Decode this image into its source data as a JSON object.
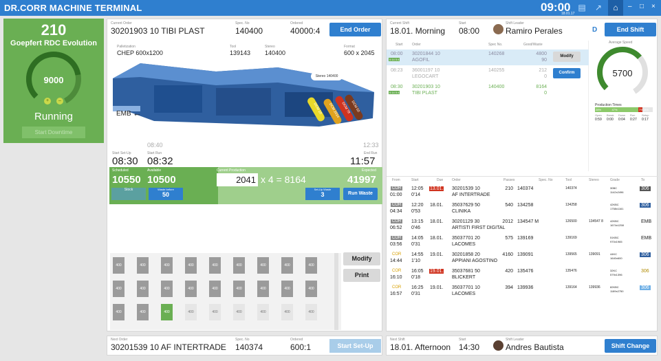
{
  "topbar": {
    "title": "DR.CORR MACHINE TERMINAL",
    "time": "09:00",
    "date": "18.01.17"
  },
  "machine": {
    "count": "210",
    "name": "Goepfert RDC Evolution",
    "speed": "9000",
    "state": "Running",
    "downtime_label": "Start Downtime",
    "speed_pct": 0.75
  },
  "order": {
    "current_label": "Current Order",
    "current": "30201903 10 TIBI PLAST",
    "spec_label": "Spec. No",
    "spec": "140400",
    "ordered_label": "Ordered",
    "ordered": "40000:4",
    "end_label": "End Order",
    "pallet_label": "Palletization",
    "pallet": "CHEP 600x1200",
    "tool_label": "Tool",
    "tool": "139143",
    "stereo_label": "Stereo",
    "stereo": "140400",
    "format_label": "Format",
    "format": "600 x 2045",
    "emb": "EMB",
    "sticker": "Stereo 140400",
    "tags": [
      "DCM 10",
      "DCM 2014",
      "DCM 78",
      "DCM 50"
    ],
    "t1": "08:40",
    "t2": "12:33",
    "setup_label": "Start Set-Up",
    "setup": "08:30",
    "run_label": "Start Run",
    "run": "08:32",
    "endrun_label": "End Run",
    "endrun": "11:57",
    "sched_label": "Scheduled",
    "sched": "10550",
    "avail_label": "Available",
    "avail": "10500",
    "curprod_label": "Current Production",
    "curprod": "2041",
    "formula": "x 4 = 8164",
    "expected_label": "Expected",
    "expected": "41997",
    "stock_label": "Stock",
    "wbefore_label": "Waste before",
    "wbefore": "50",
    "setupwaste_label": "Set-Up Waste",
    "setupwaste": "3",
    "runwaste_label": "Run Waste",
    "modify_label": "Modify",
    "print_label": "Print"
  },
  "sheets": [
    {
      "n": "1",
      "v": "400",
      "s": "f"
    },
    {
      "n": "2",
      "v": "400",
      "s": "f"
    },
    {
      "n": "3",
      "v": "400",
      "s": "f"
    },
    {
      "n": "4",
      "v": "400",
      "s": "f"
    },
    {
      "n": "5",
      "v": "400",
      "s": "f"
    },
    {
      "n": "6",
      "v": "400",
      "s": "f"
    },
    {
      "n": "7",
      "v": "400",
      "s": "f"
    },
    {
      "n": "8",
      "v": "400",
      "s": "f"
    },
    {
      "n": "9",
      "v": "400",
      "s": "f"
    },
    {
      "n": "10",
      "v": "400",
      "s": "f"
    },
    {
      "n": "11",
      "v": "400",
      "s": "f"
    },
    {
      "n": "12",
      "v": "400",
      "s": "f"
    },
    {
      "n": "13",
      "v": "400",
      "s": "f"
    },
    {
      "n": "14",
      "v": "400",
      "s": "f"
    },
    {
      "n": "15",
      "v": "400",
      "s": "f"
    },
    {
      "n": "16",
      "v": "400",
      "s": "f"
    },
    {
      "n": "17",
      "v": "400",
      "s": "f"
    },
    {
      "n": "18",
      "v": "400",
      "s": "f"
    },
    {
      "n": "19",
      "v": "400",
      "s": "f"
    },
    {
      "n": "20",
      "v": "400",
      "s": "f"
    },
    {
      "n": "21",
      "v": "400",
      "s": "a"
    },
    {
      "n": "22",
      "v": "400",
      "s": "e"
    },
    {
      "n": "23",
      "v": "400",
      "s": "e"
    },
    {
      "n": "24",
      "v": "400",
      "s": "e"
    },
    {
      "n": "25",
      "v": "400",
      "s": "e"
    },
    {
      "n": "26",
      "v": "400",
      "s": "e"
    },
    {
      "n": "27",
      "v": "400",
      "s": "e"
    }
  ],
  "next": {
    "label": "Next Order",
    "order": "30201539 10 AF INTERTRADE",
    "spec_label": "Spec. No",
    "spec": "140374",
    "ordered_label": "Ordered",
    "ordered": "600:1",
    "btn": "Start Set-Up"
  },
  "shift": {
    "cur_label": "Current Shift",
    "cur": "18.01. Morning",
    "start_label": "Start",
    "start": "08:00",
    "leader_label": "Shift Leader",
    "leader": "Ramiro Perales",
    "d": "D",
    "end_label": "End Shift",
    "avg_label": "Average Speed",
    "avg": "5700",
    "avg_pct": 0.65,
    "pt_label": "Production Times",
    "pt_pcts": [
      "28%",
      "47%",
      "7%",
      "18%"
    ],
    "pt_heads": [
      "Open",
      "Break",
      "Down",
      "Run",
      "Setup"
    ],
    "pt_vals": [
      "0:59",
      "0:00",
      "0:04",
      "0:27",
      "0:17"
    ],
    "modify_label": "Modify",
    "confirm_label": "Confirm",
    "hdr": [
      "Start",
      "Order",
      "Spec No.",
      "Good/Waste"
    ],
    "rows": [
      {
        "t": "08:00",
        "b": "0:14 0:4",
        "o1": "30201844 10",
        "o2": "AGOFIL",
        "spec": "140268",
        "g": "4800",
        "w": "90"
      },
      {
        "t": "08:23",
        "b": "",
        "o1": "36001197 10",
        "o2": "LEGOCART",
        "spec": "140255",
        "g": "212",
        "w": "0"
      },
      {
        "t": "08:30",
        "b": "0:14 0:4",
        "o1": "30201903 10",
        "o2": "TIBI PLAST",
        "spec": "140400",
        "g": "8164",
        "w": "0"
      }
    ]
  },
  "queue": {
    "hdr": [
      "From",
      "Start",
      "Due",
      "Order",
      "Passes",
      "Spec. No",
      "Tool",
      "Stereo",
      "Grade",
      "To"
    ],
    "rows": [
      {
        "from1": "COR",
        "from2": "01:00",
        "s1": "12:05",
        "s2": "0'14",
        "due": "13.01.",
        "due_red": true,
        "o1": "30201539 10",
        "o2": "AF INTERTRADE",
        "passes": "210",
        "spec": "140374",
        "tool": "140374",
        "stereo": "",
        "g1": "30BC",
        "g2": "1142x2496",
        "to": "306",
        "to_style": "dark"
      },
      {
        "from1": "COR",
        "from2": "04:34",
        "s1": "12:20",
        "s2": "0'53",
        "due": "18.01.",
        "due_red": false,
        "o1": "35037629 50",
        "o2": "CLINIKA",
        "passes": "540",
        "spec": "134258",
        "tool": "134258",
        "stereo": "",
        "g1": "42KBC",
        "g2": "1758x1161",
        "to": "306",
        "to_style": "blue"
      },
      {
        "from1": "COR",
        "from2": "06:52",
        "s1": "13:15",
        "s2": "0'46",
        "due": "18.01.",
        "due_red": false,
        "o1": "30201129 30",
        "o2": "ARTISTI FIRST DIGITAL",
        "passes": "2012",
        "spec": "134547 M",
        "tool": "126500",
        "stereo": "134547 8",
        "g1": "42KBC",
        "g2": "1674x1258",
        "to": "EMB",
        "to_style": "none"
      },
      {
        "from1": "COR",
        "from2": "03:56",
        "s1": "14:05",
        "s2": "0'31",
        "due": "18.01.",
        "due_red": false,
        "o1": "35037701 20",
        "o2": "LACOMES",
        "passes": "575",
        "spec": "139169",
        "tool": "139169",
        "stereo": "",
        "g1": "51KBC",
        "g2": "970x1965",
        "to": "EMB",
        "to_style": "none"
      },
      {
        "from1": "COR",
        "from2": "14:44",
        "s1": "14:55",
        "s2": "1'10",
        "due": "19.01.",
        "due_red": false,
        "o1": "30201858 20",
        "o2": "APPIANI AGOSTINO",
        "passes": "4160",
        "spec": "139091",
        "tool": "139565",
        "stereo": "139091",
        "g1": "44KC",
        "g2": "1640x600",
        "to": "306",
        "to_style": "blue"
      },
      {
        "from1": "COR",
        "from2": "16:10",
        "s1": "16:05",
        "s2": "0'18",
        "due": "19.01.",
        "due_red": true,
        "o1": "35037681 50",
        "o2": "BLICKERT",
        "passes": "420",
        "spec": "135476",
        "tool": "135476",
        "stereo": "",
        "g1": "32KC",
        "g2": "579x1396",
        "to": "306",
        "to_style": "yellow"
      },
      {
        "from1": "COR",
        "from2": "16:57",
        "s1": "16:25",
        "s2": "0'31",
        "due": "19.01.",
        "due_red": false,
        "o1": "35037701 10",
        "o2": "LACOMES",
        "passes": "394",
        "spec": "139936",
        "tool": "139164",
        "stereo": "139936",
        "g1": "82KBC",
        "g2": "1189x2750",
        "to": "306",
        "to_style": "lightblue"
      }
    ]
  },
  "nextshift": {
    "label": "Next Shift",
    "shift": "18.01. Afternoon",
    "start_label": "Start",
    "start": "14:30",
    "leader_label": "Shift Leader",
    "leader": "Andres Bautista",
    "btn": "Shift Change"
  }
}
